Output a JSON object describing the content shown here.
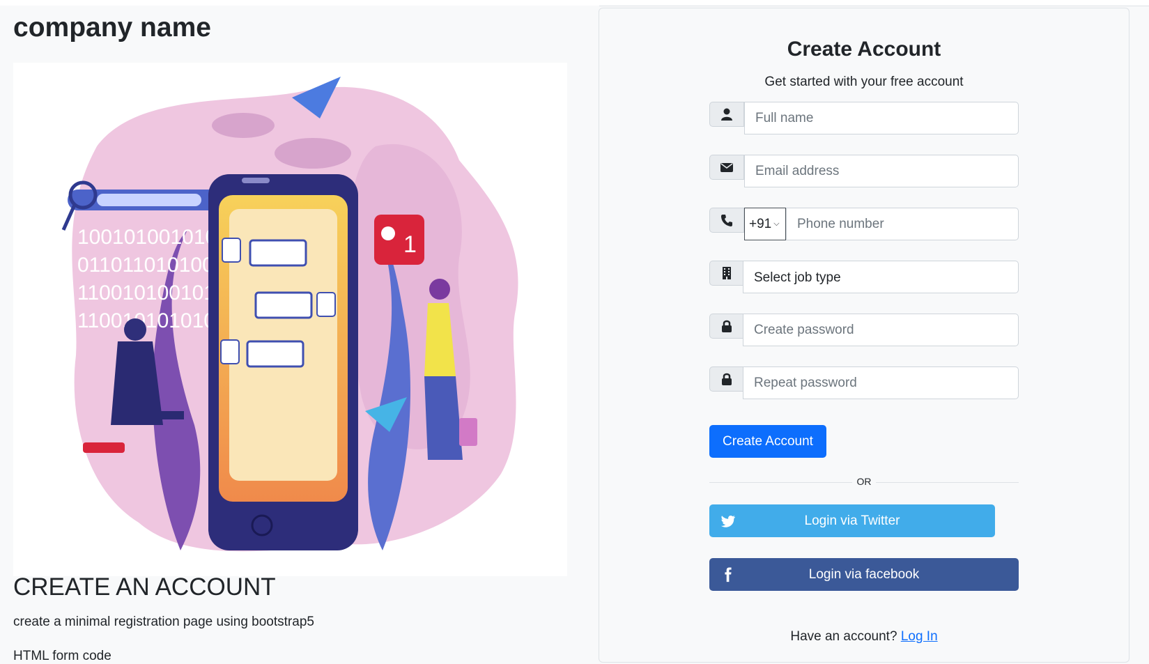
{
  "company": {
    "name": "company name"
  },
  "hero": {
    "binary_lines": [
      "100101001010101",
      "011011010100010",
      "110010100101010",
      "110010101010101"
    ],
    "badge_count": "1"
  },
  "intro": {
    "headline": "CREATE AN ACCOUNT",
    "description": "create a minimal registration page using bootstrap5",
    "cutoff_text": "HTML form code"
  },
  "form": {
    "title": "Create Account",
    "subtitle": "Get started with your free account",
    "fullname_placeholder": "Full name",
    "email_placeholder": "Email address",
    "country_code": "+91",
    "phone_placeholder": "Phone number",
    "job_placeholder": "Select job type",
    "password_placeholder": "Create password",
    "repeat_password_placeholder": "Repeat password",
    "submit_label": "Create Account",
    "or_label": "OR",
    "twitter_label": "Login via Twitter",
    "facebook_label": "Login via facebook",
    "have_account_text": "Have an account?",
    "login_link": "Log In"
  },
  "colors": {
    "primary": "#0d6efd",
    "twitter": "#41acea",
    "facebook": "#3b5998",
    "page_bg": "#f8f9fa"
  },
  "icons": [
    "user-icon",
    "envelope-icon",
    "phone-icon",
    "building-icon",
    "lock-icon",
    "lock-icon",
    "twitter-icon",
    "facebook-icon"
  ]
}
